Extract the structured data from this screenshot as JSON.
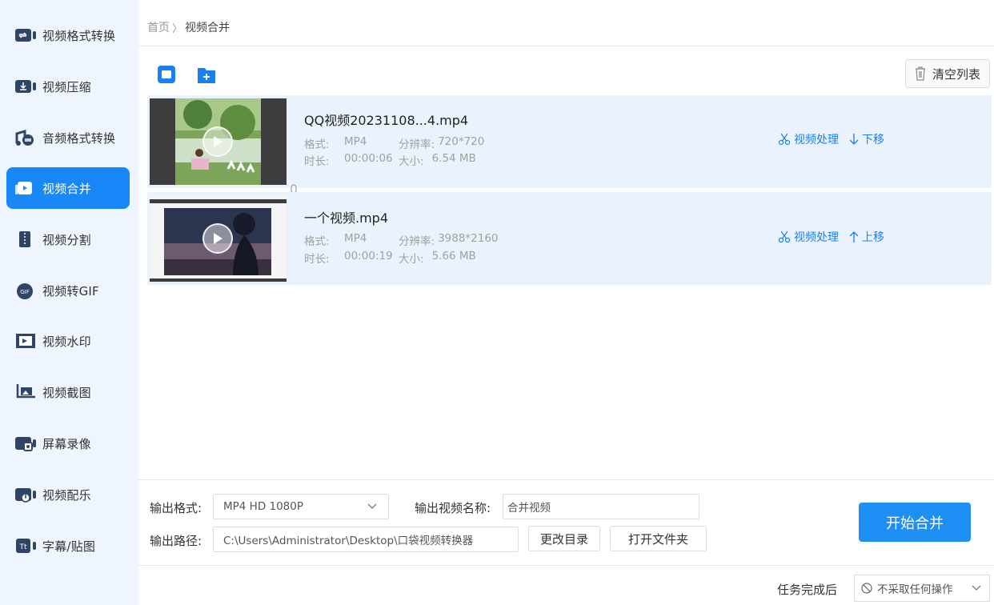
{
  "sidebar": {
    "items": [
      {
        "label": "视频格式转换",
        "icon": "video-convert-icon"
      },
      {
        "label": "视频压缩",
        "icon": "video-compress-icon"
      },
      {
        "label": "音频格式转换",
        "icon": "audio-convert-icon"
      },
      {
        "label": "视频合并",
        "icon": "video-merge-icon",
        "active": true
      },
      {
        "label": "视频分割",
        "icon": "video-split-icon"
      },
      {
        "label": "视频转GIF",
        "icon": "gif-icon"
      },
      {
        "label": "视频水印",
        "icon": "watermark-icon"
      },
      {
        "label": "视频截图",
        "icon": "screenshot-icon"
      },
      {
        "label": "屏幕录像",
        "icon": "screen-record-icon"
      },
      {
        "label": "视频配乐",
        "icon": "music-icon"
      },
      {
        "label": "字幕/贴图",
        "icon": "subtitle-icon"
      }
    ]
  },
  "breadcrumb": {
    "home": "首页",
    "sep": "〉",
    "current": "视频合并"
  },
  "toolbar": {
    "clear_label": "清空列表"
  },
  "files": [
    {
      "name": "QQ视频20231108...4.mp4",
      "format_label": "格式:",
      "format": "MP4",
      "res_label": "分辨率:",
      "resolution": "720*720",
      "dur_label": "时长:",
      "duration": "00:00:06",
      "size_label": "大小:",
      "size": "6.54 MB",
      "process_label": "视频处理",
      "move_label": "下移"
    },
    {
      "name": "一个视频.mp4",
      "format_label": "格式:",
      "format": "MP4",
      "res_label": "分辨率:",
      "resolution": "3988*2160",
      "dur_label": "时长:",
      "duration": "00:00:19",
      "size_label": "大小:",
      "size": "5.66 MB",
      "process_label": "视频处理",
      "move_label": "上移"
    }
  ],
  "output": {
    "format_label": "输出格式:",
    "format_value": "MP4  HD 1080P",
    "name_label": "输出视频名称:",
    "name_value": "合并视频",
    "path_label": "输出路径:",
    "path_value": "C:\\Users\\Administrator\\Desktop\\口袋视频转换器",
    "change_dir": "更改目录",
    "open_folder": "打开文件夹",
    "start": "开始合并"
  },
  "after_task": {
    "label": "任务完成后",
    "value": "不采取任何操作"
  },
  "colors": {
    "accent": "#1887f8",
    "row_bg": "#eaf3fd",
    "sidebar_bg": "#eef5fe"
  }
}
